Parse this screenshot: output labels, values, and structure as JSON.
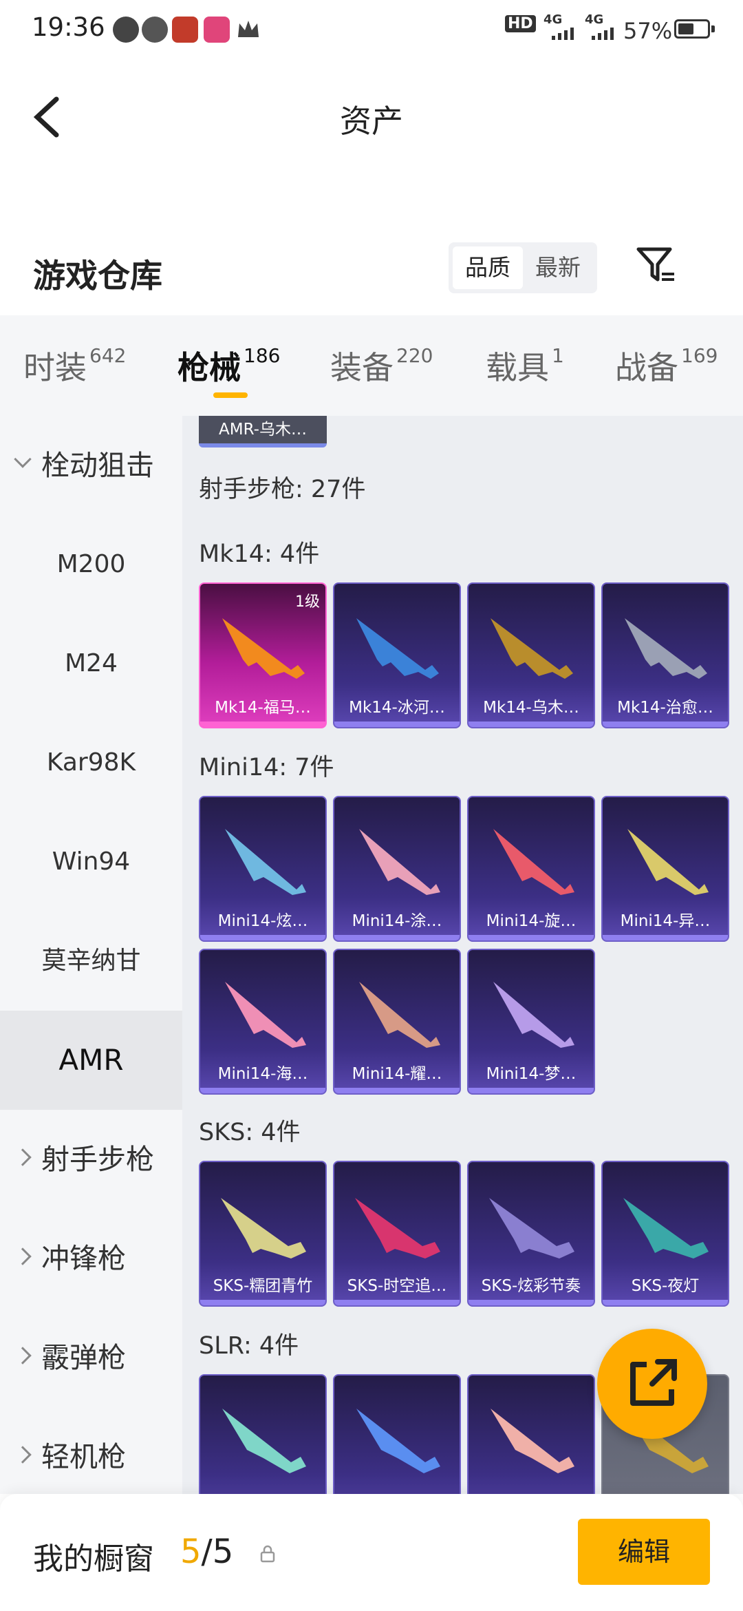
{
  "status_bar": {
    "time": "19:36",
    "battery": "57%",
    "net1": "4G",
    "net2": "4G",
    "hd": "HD"
  },
  "header": {
    "title": "资产"
  },
  "section": {
    "title": "游戏仓库",
    "sort_options": [
      "品质",
      "最新"
    ],
    "sort_active": "品质"
  },
  "tabs": [
    {
      "label": "时装",
      "count": "642"
    },
    {
      "label": "枪械",
      "count": "186"
    },
    {
      "label": "装备",
      "count": "220"
    },
    {
      "label": "载具",
      "count": "1"
    },
    {
      "label": "战备",
      "count": "169"
    }
  ],
  "active_tab": "枪械",
  "sidebar": {
    "group_open": "栓动狙击",
    "items": [
      "M200",
      "M24",
      "Kar98K",
      "Win94",
      "莫辛纳甘",
      "AMR"
    ],
    "active_item": "AMR",
    "groups_closed": [
      "射手步枪",
      "冲锋枪",
      "霰弹枪",
      "轻机枪"
    ]
  },
  "content": {
    "partial_card_label": "AMR-乌木…",
    "category_summary": "射手步枪: 27件",
    "groups": [
      {
        "title": "Mk14: 4件",
        "items": [
          {
            "label": "Mk14-福马…",
            "level": "1级"
          },
          {
            "label": "Mk14-冰河…"
          },
          {
            "label": "Mk14-乌木…"
          },
          {
            "label": "Mk14-治愈…"
          }
        ]
      },
      {
        "title": "Mini14: 7件",
        "items": [
          {
            "label": "Mini14-炫…"
          },
          {
            "label": "Mini14-涂…"
          },
          {
            "label": "Mini14-旋…"
          },
          {
            "label": "Mini14-异…"
          },
          {
            "label": "Mini14-海…"
          },
          {
            "label": "Mini14-耀…"
          },
          {
            "label": "Mini14-梦…"
          }
        ]
      },
      {
        "title": "SKS: 4件",
        "items": [
          {
            "label": "SKS-糯团青竹"
          },
          {
            "label": "SKS-时空追…"
          },
          {
            "label": "SKS-炫彩节奏"
          },
          {
            "label": "SKS-夜灯"
          }
        ]
      },
      {
        "title": "SLR: 4件",
        "items": [
          {
            "label": ""
          },
          {
            "label": ""
          },
          {
            "label": ""
          },
          {
            "label": ""
          }
        ]
      }
    ]
  },
  "bottom": {
    "label": "我的橱窗",
    "count_current": "5",
    "count_sep": "/",
    "count_total": "5",
    "edit_label": "编辑"
  },
  "colors": {
    "accent": "#ffb400",
    "card_purple": "#3c2f85",
    "card_pink": "#b21d99"
  }
}
